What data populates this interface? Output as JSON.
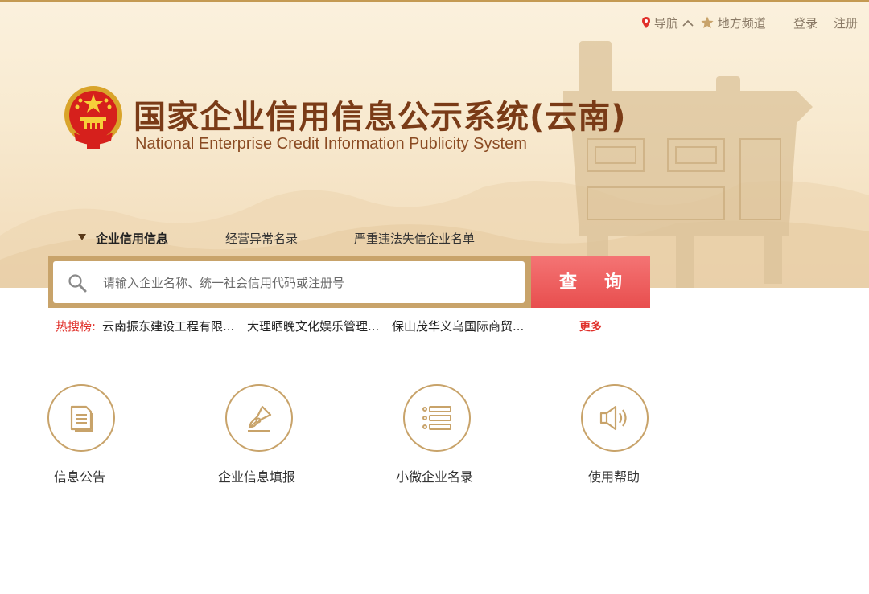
{
  "topbar": {
    "nav_label": "导航",
    "region_label": "地方频道",
    "login_label": "登录",
    "register_label": "注册"
  },
  "header": {
    "title_cn": "国家企业信用信息公示系统(云南)",
    "title_en": "National Enterprise Credit Information Publicity System"
  },
  "tabs": [
    {
      "label": "企业信用信息",
      "active": true
    },
    {
      "label": "经营异常名录",
      "active": false
    },
    {
      "label": "严重违法失信企业名单",
      "active": false
    }
  ],
  "search": {
    "placeholder": "请输入企业名称、统一社会信用代码或注册号",
    "button_label": "查 询"
  },
  "hot_search": {
    "label": "热搜榜:",
    "items": [
      "云南振东建设工程有限...",
      "大理晒晚文化娱乐管理...",
      "保山茂华义乌国际商贸..."
    ],
    "more_label": "更多"
  },
  "features": [
    {
      "label": "信息公告",
      "icon": "document-icon"
    },
    {
      "label": "企业信息填报",
      "icon": "pen-nib-icon"
    },
    {
      "label": "小微企业名录",
      "icon": "list-icon"
    },
    {
      "label": "使用帮助",
      "icon": "speaker-icon"
    }
  ],
  "colors": {
    "accent_gold": "#c8a36a",
    "button_red": "#ea5252",
    "hot_red": "#e0302a",
    "title_brown": "#7a3b17"
  }
}
